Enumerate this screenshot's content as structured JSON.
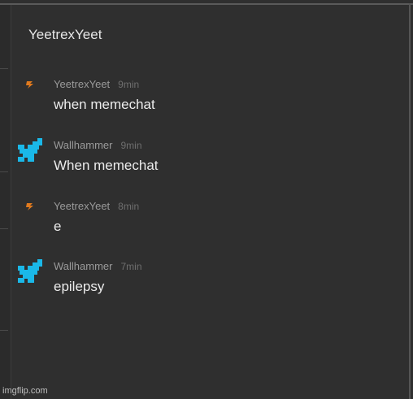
{
  "chat": {
    "title": "YeetrexYeet"
  },
  "colors": {
    "background": "#2f2f2f",
    "yeetrex_avatar": "#e07a1e",
    "wallhammer_avatar": "#1ab8e8"
  },
  "messages": [
    {
      "username": "YeetrexYeet",
      "time": "9min",
      "text": "when memechat",
      "avatar_icon": "lightning-icon"
    },
    {
      "username": "Wallhammer",
      "time": "9min",
      "text": "When memechat",
      "avatar_icon": "pixel-bird-icon"
    },
    {
      "username": "YeetrexYeet",
      "time": "8min",
      "text": "e",
      "avatar_icon": "lightning-icon"
    },
    {
      "username": "Wallhammer",
      "time": "7min",
      "text": "epilepsy",
      "avatar_icon": "pixel-bird-icon"
    }
  ],
  "watermark": "imgflip.com"
}
